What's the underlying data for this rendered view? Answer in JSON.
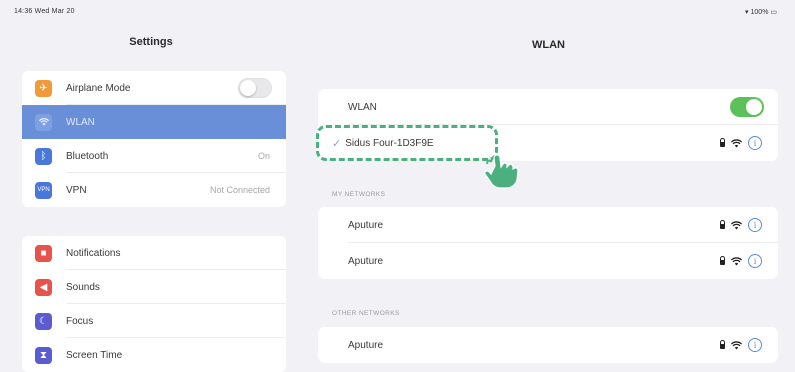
{
  "status_bar": {
    "time_date": "14:36  Wed Mar 20",
    "battery": "100%"
  },
  "sidebar": {
    "title": "Settings",
    "group1": [
      {
        "label": "Airplane Mode",
        "icon": "airplane-icon",
        "color": "#f29a38",
        "value": "",
        "control": "toggle-off"
      },
      {
        "label": "WLAN",
        "icon": "wifi-icon",
        "color": "#6a8fd9",
        "value": "",
        "active": true
      },
      {
        "label": "Bluetooth",
        "icon": "bluetooth-icon",
        "color": "#4a78d9",
        "value": "On"
      },
      {
        "label": "VPN",
        "icon": "vpn-icon",
        "color": "#4a78d9",
        "value": "Not Connected"
      }
    ],
    "group2": [
      {
        "label": "Notifications",
        "icon": "bell-icon",
        "color": "#e5534b"
      },
      {
        "label": "Sounds",
        "icon": "speaker-icon",
        "color": "#e5534b"
      },
      {
        "label": "Focus",
        "icon": "moon-icon",
        "color": "#5a5ccf"
      },
      {
        "label": "Screen Time",
        "icon": "hourglass-icon",
        "color": "#5a5ccf"
      }
    ]
  },
  "main": {
    "title": "WLAN",
    "wlan_label": "WLAN",
    "wlan_on": true,
    "connected_network": "Sidus Four-1D3F9E",
    "my_networks_label": "MY NETWORKS",
    "my_networks": [
      "Aputure",
      "Aputure"
    ],
    "other_networks_label": "OTHER NETWORKS",
    "other_networks": [
      "Aputure"
    ]
  },
  "colors": {
    "accent": "#6a8fd9",
    "toggle_on": "#5cc15a",
    "highlight": "#4cb07e"
  }
}
